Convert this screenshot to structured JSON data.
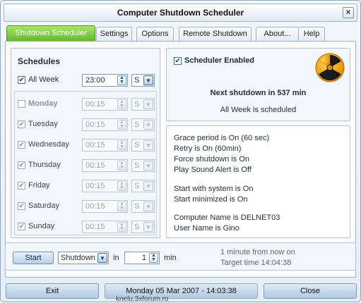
{
  "window": {
    "title": "Computer Shutdown Scheduler",
    "close_glyph": "×"
  },
  "tabs": [
    {
      "label": "Shutdown Scheduler",
      "active": true
    },
    {
      "label": "Settings",
      "active": false
    },
    {
      "label": "Options",
      "active": false
    },
    {
      "label": "Remote Shutdown",
      "active": false
    },
    {
      "label": "About...",
      "active": false
    },
    {
      "label": "Help",
      "active": false
    }
  ],
  "schedules": {
    "heading": "Schedules",
    "all_week": {
      "label": "All Week",
      "checked": true,
      "time": "23:00",
      "unit": "S"
    },
    "days": [
      {
        "label": "Monday",
        "checked": false,
        "bold": true,
        "time": "00:15",
        "unit": "S"
      },
      {
        "label": "Tuesday",
        "checked": true,
        "bold": false,
        "time": "00:15",
        "unit": "S"
      },
      {
        "label": "Wednesday",
        "checked": true,
        "bold": false,
        "time": "00:15",
        "unit": "S"
      },
      {
        "label": "Thursday",
        "checked": true,
        "bold": false,
        "time": "00:15",
        "unit": "S"
      },
      {
        "label": "Friday",
        "checked": true,
        "bold": false,
        "time": "00:15",
        "unit": "S"
      },
      {
        "label": "Saturday",
        "checked": true,
        "bold": false,
        "time": "00:15",
        "unit": "S"
      },
      {
        "label": "Sunday",
        "checked": true,
        "bold": false,
        "time": "00:15",
        "unit": "S"
      }
    ]
  },
  "status": {
    "scheduler_enabled_label": "Scheduler Enabled",
    "scheduler_enabled": true,
    "next_shutdown": "Next shutdown in 537 min",
    "schedule_note": "All Week is scheduled"
  },
  "info_lines": {
    "grace": "Grace period is On (60 sec)",
    "retry": "Retry is On (60min)",
    "force": "Force shutdown is On",
    "sound": "Play Sound Alert is Off",
    "start_system": "Start with system is On",
    "start_minimized": "Start minimized is On",
    "computer_name": "Computer Name is DELNET03",
    "user_name": "User Name is Gino"
  },
  "quick": {
    "start_label": "Start",
    "action": "Shutdown",
    "in_label": "in",
    "amount": "1",
    "unit_label": "min",
    "hint1": "1 minute from now on",
    "hint2": "Target time 14:04:38"
  },
  "footer": {
    "exit_label": "Exit",
    "datetime": "Monday 05 Mar 2007 - 14:03:38",
    "close_label": "Close"
  },
  "watermark": "knelu.3xforum.ro",
  "icons": {
    "check": "✔",
    "spin_up": "▲",
    "spin_down": "▼",
    "dropdown": "▼"
  },
  "colors": {
    "active_tab": "#62b52e",
    "accent": "#234f87"
  }
}
